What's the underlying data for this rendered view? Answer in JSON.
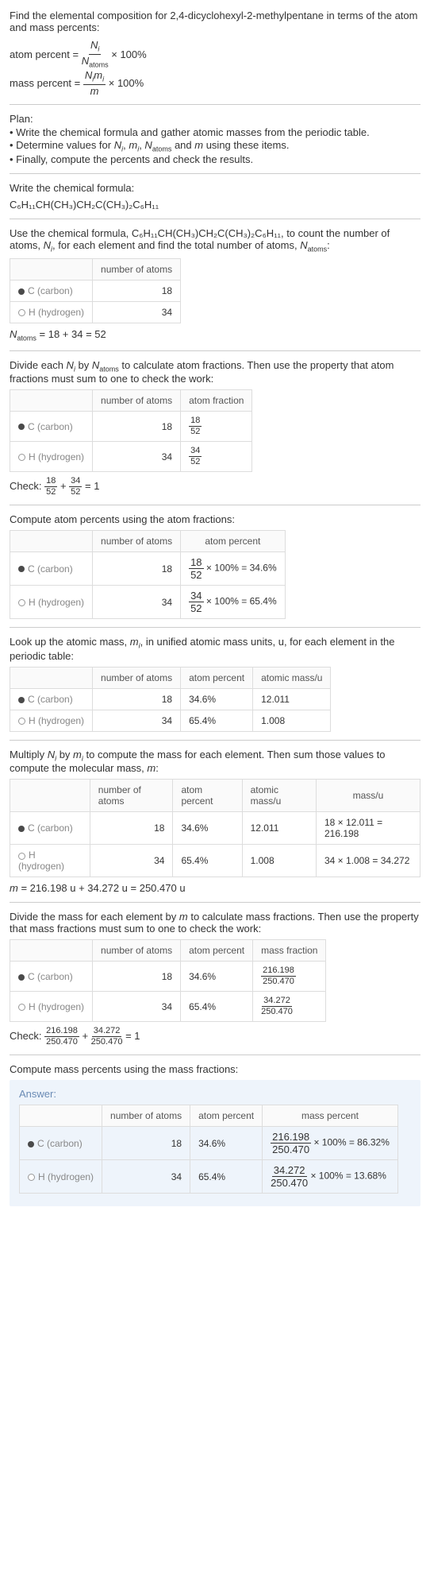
{
  "intro": "Find the elemental composition for 2,4-dicyclohexyl-2-methylpentane in terms of the atom and mass percents:",
  "atom_percent_label": "atom percent =",
  "atom_percent_frac_num": "N_i",
  "atom_percent_frac_den": "N_atoms",
  "times100": "× 100%",
  "mass_percent_label": "mass percent =",
  "mass_percent_frac_num": "N_i m_i",
  "mass_percent_frac_den": "m",
  "plan_title": "Plan:",
  "plan_items": [
    "• Write the chemical formula and gather atomic masses from the periodic table.",
    "• Determine values for N_i, m_i, N_atoms and m using these items.",
    "• Finally, compute the percents and check the results."
  ],
  "write_formula": "Write the chemical formula:",
  "chem_formula": "C₆H₁₁CH(CH₃)CH₂C(CH₃)₂C₆H₁₁",
  "use_formula_1": "Use the chemical formula, C₆H₁₁CH(CH₃)CH₂C(CH₃)₂C₆H₁₁, to count the number of atoms, ",
  "use_formula_2": ", for each element and find the total number of atoms, ",
  "use_formula_3": ":",
  "Ni_label": "N_i",
  "Natoms_label": "N_atoms",
  "headers": {
    "num_atoms": "number of atoms",
    "atom_frac": "atom fraction",
    "atom_pct": "atom percent",
    "atomic_mass": "atomic mass/u",
    "mass_u": "mass/u",
    "mass_frac": "mass fraction",
    "mass_pct": "mass percent"
  },
  "elements": {
    "C": {
      "name": "C (carbon)",
      "atoms": "18"
    },
    "H": {
      "name": "H (hydrogen)",
      "atoms": "34"
    }
  },
  "natoms_eq": "N_atoms = 18 + 34 = 52",
  "divide_ni": "Divide each N_i by N_atoms to calculate atom fractions. Then use the property that atom fractions must sum to one to check the work:",
  "frac_c": {
    "num": "18",
    "den": "52"
  },
  "frac_h": {
    "num": "34",
    "den": "52"
  },
  "check1_label": "Check: ",
  "check1_eq": " = 1",
  "compute_atom_pct": "Compute atom percents using the atom fractions:",
  "pct_c": "× 100% = 34.6%",
  "pct_h": "× 100% = 65.4%",
  "lookup": "Look up the atomic mass, m_i, in unified atomic mass units, u, for each element in the periodic table:",
  "mass_c": "12.011",
  "mass_h": "1.008",
  "pct_c_short": "34.6%",
  "pct_h_short": "65.4%",
  "multiply": "Multiply N_i by m_i to compute the mass for each element. Then sum those values to compute the molecular mass, m:",
  "massu_c": "18 × 12.011 = 216.198",
  "massu_h": "34 × 1.008 = 34.272",
  "m_eq": "m = 216.198 u + 34.272 u = 250.470 u",
  "divide_mass": "Divide the mass for each element by m to calculate mass fractions. Then use the property that mass fractions must sum to one to check the work:",
  "massfrac_c": {
    "num": "216.198",
    "den": "250.470"
  },
  "massfrac_h": {
    "num": "34.272",
    "den": "250.470"
  },
  "check2_label": "Check: ",
  "check2_eq": " = 1",
  "compute_mass_pct": "Compute mass percents using the mass fractions:",
  "answer": "Answer:",
  "masspct_c": "× 100% = 86.32%",
  "masspct_h": "× 100% = 13.68%"
}
